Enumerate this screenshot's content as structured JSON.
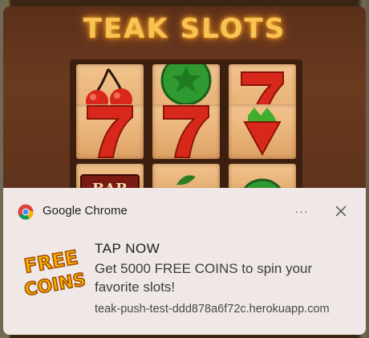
{
  "promo": {
    "title": "TEAK SLOTS",
    "reel_symbols": [
      "cherry",
      "wild-coin",
      "seven",
      "seven",
      "seven",
      "strawberry",
      "bar",
      "leaf",
      "coin"
    ],
    "bar_label": "BAR"
  },
  "notification": {
    "app_name": "Google Chrome",
    "more_label": "···",
    "title": "TAP NOW",
    "body": "Get 5000 FREE COINS to spin your favorite slots!",
    "source": "teak-push-test-ddd878a6f72c.herokuapp.com",
    "banner_text_top": "FREE",
    "banner_text_bottom": "COINS",
    "icons": {
      "app": "chrome-icon",
      "more": "more-options-icon",
      "close": "close-icon"
    }
  },
  "colors": {
    "card_background": "#efe8e6",
    "title_glow": "#f7c453",
    "symbol_red": "#d8281c",
    "symbol_green": "#2e9a2f"
  }
}
